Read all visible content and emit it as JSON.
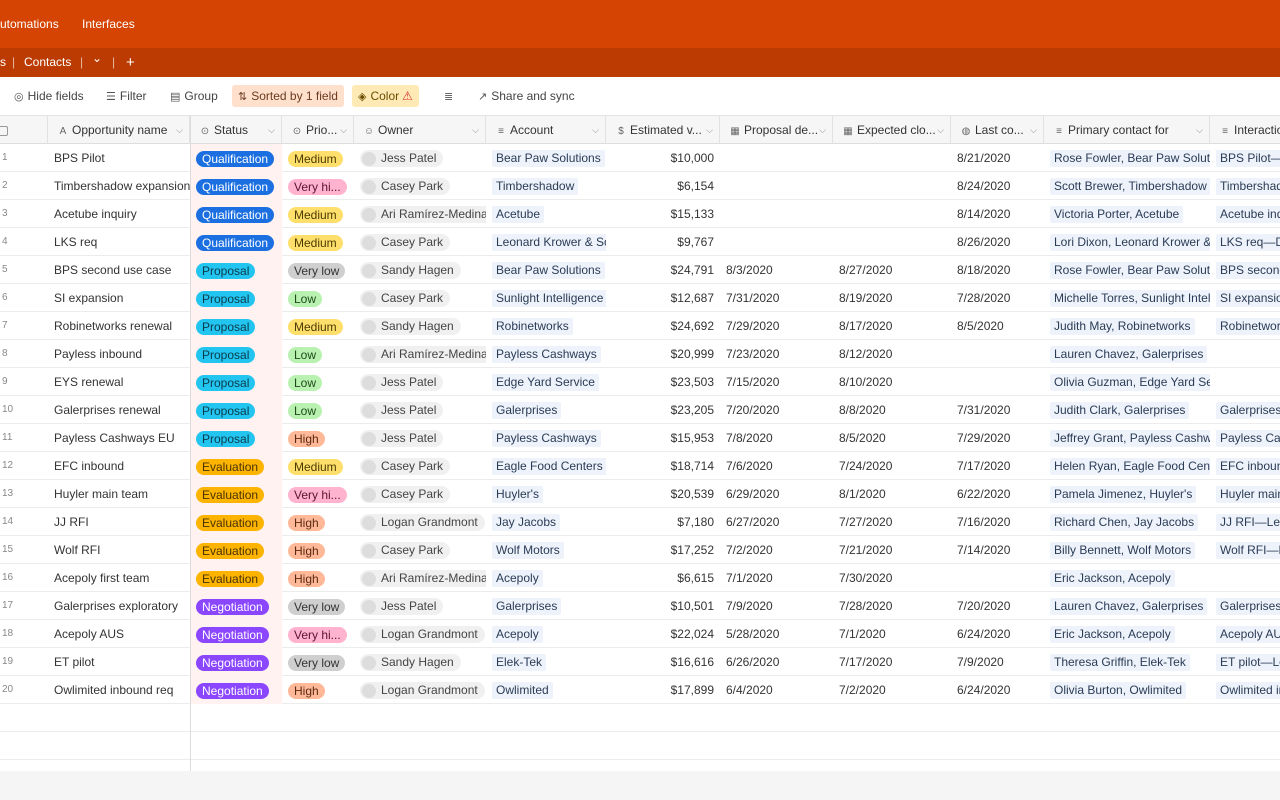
{
  "topnav": {
    "automations": "utomations",
    "interfaces": "Interfaces"
  },
  "tabbar": {
    "left_fragment": "s",
    "contacts": "Contacts",
    "chevron": "⌄",
    "add": "+"
  },
  "toolbar": {
    "hide_fields": "Hide fields",
    "filter": "Filter",
    "group": "Group",
    "sorted": "Sorted by 1 field",
    "color": "Color",
    "share": "Share and sync"
  },
  "columns": [
    {
      "label": "Opportunity name",
      "icon": "A"
    },
    {
      "label": "Status",
      "icon": "⊙"
    },
    {
      "label": "Prio...",
      "icon": "⊙"
    },
    {
      "label": "Owner",
      "icon": "☺"
    },
    {
      "label": "Account",
      "icon": "≡"
    },
    {
      "label": "Estimated v...",
      "icon": "$"
    },
    {
      "label": "Proposal de...",
      "icon": "▦"
    },
    {
      "label": "Expected clo...",
      "icon": "▦"
    },
    {
      "label": "Last co...",
      "icon": "◍"
    },
    {
      "label": "Primary contact for",
      "icon": "≡"
    },
    {
      "label": "Interactio",
      "icon": "≡"
    }
  ],
  "status_colors": {
    "Qualification": {
      "bg": "#1b6fe0",
      "fg": "#ffffff"
    },
    "Proposal": {
      "bg": "#22c4f0",
      "fg": "#0b3b4a"
    },
    "Evaluation": {
      "bg": "#fcb400",
      "fg": "#4a3200"
    },
    "Negotiation": {
      "bg": "#8b46ff",
      "fg": "#ffffff"
    }
  },
  "priority_colors": {
    "Medium": {
      "bg": "#ffdf6b",
      "fg": "#4a3a00"
    },
    "Very hi...": {
      "bg": "#ffb3cf",
      "fg": "#5a1430"
    },
    "Very low": {
      "bg": "#cfcfcf",
      "fg": "#333333"
    },
    "Low": {
      "bg": "#b9f1b0",
      "fg": "#1e4a1a"
    },
    "High": {
      "bg": "#ffb998",
      "fg": "#5a2a12"
    }
  },
  "rows": [
    {
      "n": "1",
      "name": "BPS Pilot",
      "status": "Qualification",
      "priority": "Medium",
      "owner": "Jess Patel",
      "account": "Bear Paw Solutions",
      "value": "$10,000",
      "proposal": "",
      "expected": "",
      "last": "8/21/2020",
      "contact": "Rose Fowler, Bear Paw Solution",
      "interaction": "BPS Pilot—P"
    },
    {
      "n": "2",
      "name": "Timbershadow expansion",
      "status": "Qualification",
      "priority": "Very hi...",
      "owner": "Casey Park",
      "account": "Timbershadow",
      "value": "$6,154",
      "proposal": "",
      "expected": "",
      "last": "8/24/2020",
      "contact": "Scott Brewer, Timbershadow",
      "interaction": "Timbershado"
    },
    {
      "n": "3",
      "name": "Acetube inquiry",
      "status": "Qualification",
      "priority": "Medium",
      "owner": "Ari Ramírez-Medina",
      "account": "Acetube",
      "value": "$15,133",
      "proposal": "",
      "expected": "",
      "last": "8/14/2020",
      "contact": "Victoria Porter, Acetube",
      "interaction": "Acetube inqu"
    },
    {
      "n": "4",
      "name": "LKS req",
      "status": "Qualification",
      "priority": "Medium",
      "owner": "Casey Park",
      "account": "Leonard Krower & Sor",
      "value": "$9,767",
      "proposal": "",
      "expected": "",
      "last": "8/26/2020",
      "contact": "Lori Dixon, Leonard Krower & S",
      "interaction": "LKS req—De"
    },
    {
      "n": "5",
      "name": "BPS second use case",
      "status": "Proposal",
      "priority": "Very low",
      "owner": "Sandy Hagen",
      "account": "Bear Paw Solutions",
      "value": "$24,791",
      "proposal": "8/3/2020",
      "expected": "8/27/2020",
      "last": "8/18/2020",
      "contact": "Rose Fowler, Bear Paw Solution",
      "interaction": "BPS second"
    },
    {
      "n": "6",
      "name": "SI expansion",
      "status": "Proposal",
      "priority": "Low",
      "owner": "Casey Park",
      "account": "Sunlight Intelligence",
      "value": "$12,687",
      "proposal": "7/31/2020",
      "expected": "8/19/2020",
      "last": "7/28/2020",
      "contact": "Michelle Torres, Sunlight Intelli",
      "interaction": "SI expansion"
    },
    {
      "n": "7",
      "name": "Robinetworks renewal",
      "status": "Proposal",
      "priority": "Medium",
      "owner": "Sandy Hagen",
      "account": "Robinetworks",
      "value": "$24,692",
      "proposal": "7/29/2020",
      "expected": "8/17/2020",
      "last": "8/5/2020",
      "contact": "Judith May, Robinetworks",
      "interaction": "Robinetwork"
    },
    {
      "n": "8",
      "name": "Payless inbound",
      "status": "Proposal",
      "priority": "Low",
      "owner": "Ari Ramírez-Medina",
      "account": "Payless Cashways",
      "value": "$20,999",
      "proposal": "7/23/2020",
      "expected": "8/12/2020",
      "last": "",
      "contact": "Lauren Chavez, Galerprises",
      "interaction": ""
    },
    {
      "n": "9",
      "name": "EYS renewal",
      "status": "Proposal",
      "priority": "Low",
      "owner": "Jess Patel",
      "account": "Edge Yard Service",
      "value": "$23,503",
      "proposal": "7/15/2020",
      "expected": "8/10/2020",
      "last": "",
      "contact": "Olivia Guzman, Edge Yard Servi",
      "interaction": ""
    },
    {
      "n": "10",
      "name": "Galerprises renewal",
      "status": "Proposal",
      "priority": "Low",
      "owner": "Jess Patel",
      "account": "Galerprises",
      "value": "$23,205",
      "proposal": "7/20/2020",
      "expected": "8/8/2020",
      "last": "7/31/2020",
      "contact": "Judith Clark, Galerprises",
      "interaction": "Galerprises r"
    },
    {
      "n": "11",
      "name": "Payless Cashways EU",
      "status": "Proposal",
      "priority": "High",
      "owner": "Jess Patel",
      "account": "Payless Cashways",
      "value": "$15,953",
      "proposal": "7/8/2020",
      "expected": "8/5/2020",
      "last": "7/29/2020",
      "contact": "Jeffrey Grant, Payless Cashways",
      "interaction": "Payless Cash"
    },
    {
      "n": "12",
      "name": "EFC inbound",
      "status": "Evaluation",
      "priority": "Medium",
      "owner": "Casey Park",
      "account": "Eagle Food Centers",
      "value": "$18,714",
      "proposal": "7/6/2020",
      "expected": "7/24/2020",
      "last": "7/17/2020",
      "contact": "Helen Ryan, Eagle Food Center",
      "interaction": "EFC inbound"
    },
    {
      "n": "13",
      "name": "Huyler main team",
      "status": "Evaluation",
      "priority": "Very hi...",
      "owner": "Casey Park",
      "account": "Huyler's",
      "value": "$20,539",
      "proposal": "6/29/2020",
      "expected": "8/1/2020",
      "last": "6/22/2020",
      "contact": "Pamela Jimenez, Huyler's",
      "interaction": "Huyler main"
    },
    {
      "n": "14",
      "name": "JJ RFI",
      "status": "Evaluation",
      "priority": "High",
      "owner": "Logan Grandmont",
      "account": "Jay Jacobs",
      "value": "$7,180",
      "proposal": "6/27/2020",
      "expected": "7/27/2020",
      "last": "7/16/2020",
      "contact": "Richard Chen, Jay Jacobs",
      "interaction": "JJ RFI—Lega"
    },
    {
      "n": "15",
      "name": "Wolf RFI",
      "status": "Evaluation",
      "priority": "High",
      "owner": "Casey Park",
      "account": "Wolf Motors",
      "value": "$17,252",
      "proposal": "7/2/2020",
      "expected": "7/21/2020",
      "last": "7/14/2020",
      "contact": "Billy Bennett, Wolf Motors",
      "interaction": "Wolf RFI—D"
    },
    {
      "n": "16",
      "name": "Acepoly first team",
      "status": "Evaluation",
      "priority": "High",
      "owner": "Ari Ramírez-Medina",
      "account": "Acepoly",
      "value": "$6,615",
      "proposal": "7/1/2020",
      "expected": "7/30/2020",
      "last": "",
      "contact": "Eric Jackson, Acepoly",
      "interaction": ""
    },
    {
      "n": "17",
      "name": "Galerprises exploratory",
      "status": "Negotiation",
      "priority": "Very low",
      "owner": "Jess Patel",
      "account": "Galerprises",
      "value": "$10,501",
      "proposal": "7/9/2020",
      "expected": "7/28/2020",
      "last": "7/20/2020",
      "contact": "Lauren Chavez, Galerprises",
      "interaction": "Galerprises e"
    },
    {
      "n": "18",
      "name": "Acepoly AUS",
      "status": "Negotiation",
      "priority": "Very hi...",
      "owner": "Logan Grandmont",
      "account": "Acepoly",
      "value": "$22,024",
      "proposal": "5/28/2020",
      "expected": "7/1/2020",
      "last": "6/24/2020",
      "contact": "Eric Jackson, Acepoly",
      "interaction": "Acepoly AUS"
    },
    {
      "n": "19",
      "name": "ET pilot",
      "status": "Negotiation",
      "priority": "Very low",
      "owner": "Sandy Hagen",
      "account": "Elek-Tek",
      "value": "$16,616",
      "proposal": "6/26/2020",
      "expected": "7/17/2020",
      "last": "7/9/2020",
      "contact": "Theresa Griffin, Elek-Tek",
      "interaction": "ET pilot—Le"
    },
    {
      "n": "20",
      "name": "Owlimited inbound req",
      "status": "Negotiation",
      "priority": "High",
      "owner": "Logan Grandmont",
      "account": "Owlimited",
      "value": "$17,899",
      "proposal": "6/4/2020",
      "expected": "7/2/2020",
      "last": "6/24/2020",
      "contact": "Olivia Burton, Owlimited",
      "interaction": "Owlimited in"
    }
  ]
}
